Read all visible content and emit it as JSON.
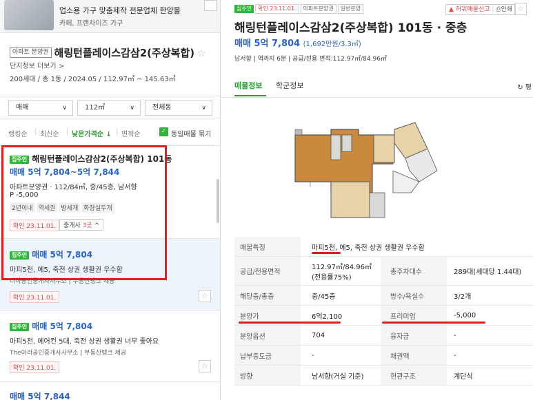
{
  "ad": {
    "title": "업소용 가구 맞춤제작 전문업체 한양몰",
    "subtitle": "카페, 프랜차이즈 가구"
  },
  "complex": {
    "type_tag": "아파트 분양권",
    "name": "해링턴플레이스감삼2(주상복합)",
    "star": "☆",
    "more_link": "단지정보 더보기 >",
    "meta": "200세대 / 총 1동 / 2024.05 / 112.97㎡ ~ 145.63㎡"
  },
  "filters": {
    "trade": "매매",
    "area": "112㎡",
    "dong": "전체동"
  },
  "sort": {
    "items": [
      "랭킹순",
      "최신순",
      "낮은가격순 ↓",
      "면적순"
    ],
    "same_listing_label": "동일매물 묶기"
  },
  "listings": [
    {
      "tag": "집주인",
      "title": "해링턴플레이스감삼2(주상복합) 101동",
      "price": "매매 5억 7,804~5억 7,844",
      "info": "아파트분양권 · 112/84㎡, 중/45층, 남서향",
      "premium": "P -5,000",
      "chips": [
        "2년이내",
        "역세권",
        "방세개",
        "화장실두개"
      ],
      "confirm": "확인 23.11.01.",
      "brokers_prefix": "중개사 ",
      "brokers_count": "3곳",
      "brokers_suffix": " ^"
    },
    {
      "tag": "집주인",
      "price": "매매 5억 7,804",
      "desc": "마피5천, 에5, 죽전 상권 생활권 우수함",
      "agency": "다하공인중개사사무소 | 부동산뱅크 제공",
      "confirm": "확인 23.11.01."
    },
    {
      "tag": "집주인",
      "price": "매매 5억 7,804",
      "desc": "마피5천, 에어컨 5대, 죽전 상권 생활권 너무 좋아요",
      "agency": "The아라공인중개사사무소 | 부동산뱅크 제공",
      "confirm": "확인 23.11.01."
    },
    {
      "price": "매매 5억 7,844"
    }
  ],
  "detail": {
    "tags": [
      "집주인",
      "확인 23.11.01.",
      "아파트분양권",
      "일반분양"
    ],
    "report": "허위매물신고",
    "print": "인쇄",
    "title": "해링턴플레이스감삼2(주상복합) 101동 · 중층",
    "price": "매매 5억 7,804",
    "unit_price": "(1,692만원/3.3㎡)",
    "meta": "남서향 | 역까지 6분 | 공급/전용 면적:112.97㎡/84.96㎡",
    "tabs": [
      "매물정보",
      "학군정보"
    ],
    "tab_right": "평",
    "table": [
      {
        "k1": "매물특징",
        "v1": "마피5천, 에5, 죽전 상권 생활권 우수함"
      },
      {
        "k1": "공급/전용면적",
        "v1": "112.97㎡/84.96㎡(전용률75%)",
        "k2": "총주차대수",
        "v2": "289대(세대당 1.44대)"
      },
      {
        "k1": "해당층/총층",
        "v1": "중/45층",
        "k2": "방수/욕실수",
        "v2": "3/2개"
      },
      {
        "k1": "분양가",
        "v1": "6억2,100",
        "k2": "프리미엄",
        "v2": "-5,000"
      },
      {
        "k1": "분양옵션",
        "v1": "704",
        "k2": "융자금",
        "v2": "-"
      },
      {
        "k1": "납부중도금",
        "v1": "-",
        "k2": "채권액",
        "v2": "-"
      },
      {
        "k1": "방향",
        "v1": "남서향(거실 기준)",
        "k2": "현관구조",
        "v2": "계단식"
      }
    ]
  },
  "colors": {
    "accent_green": "#2fb53a",
    "price_blue": "#2a62c8",
    "highlight_red": "#e21b1b"
  }
}
